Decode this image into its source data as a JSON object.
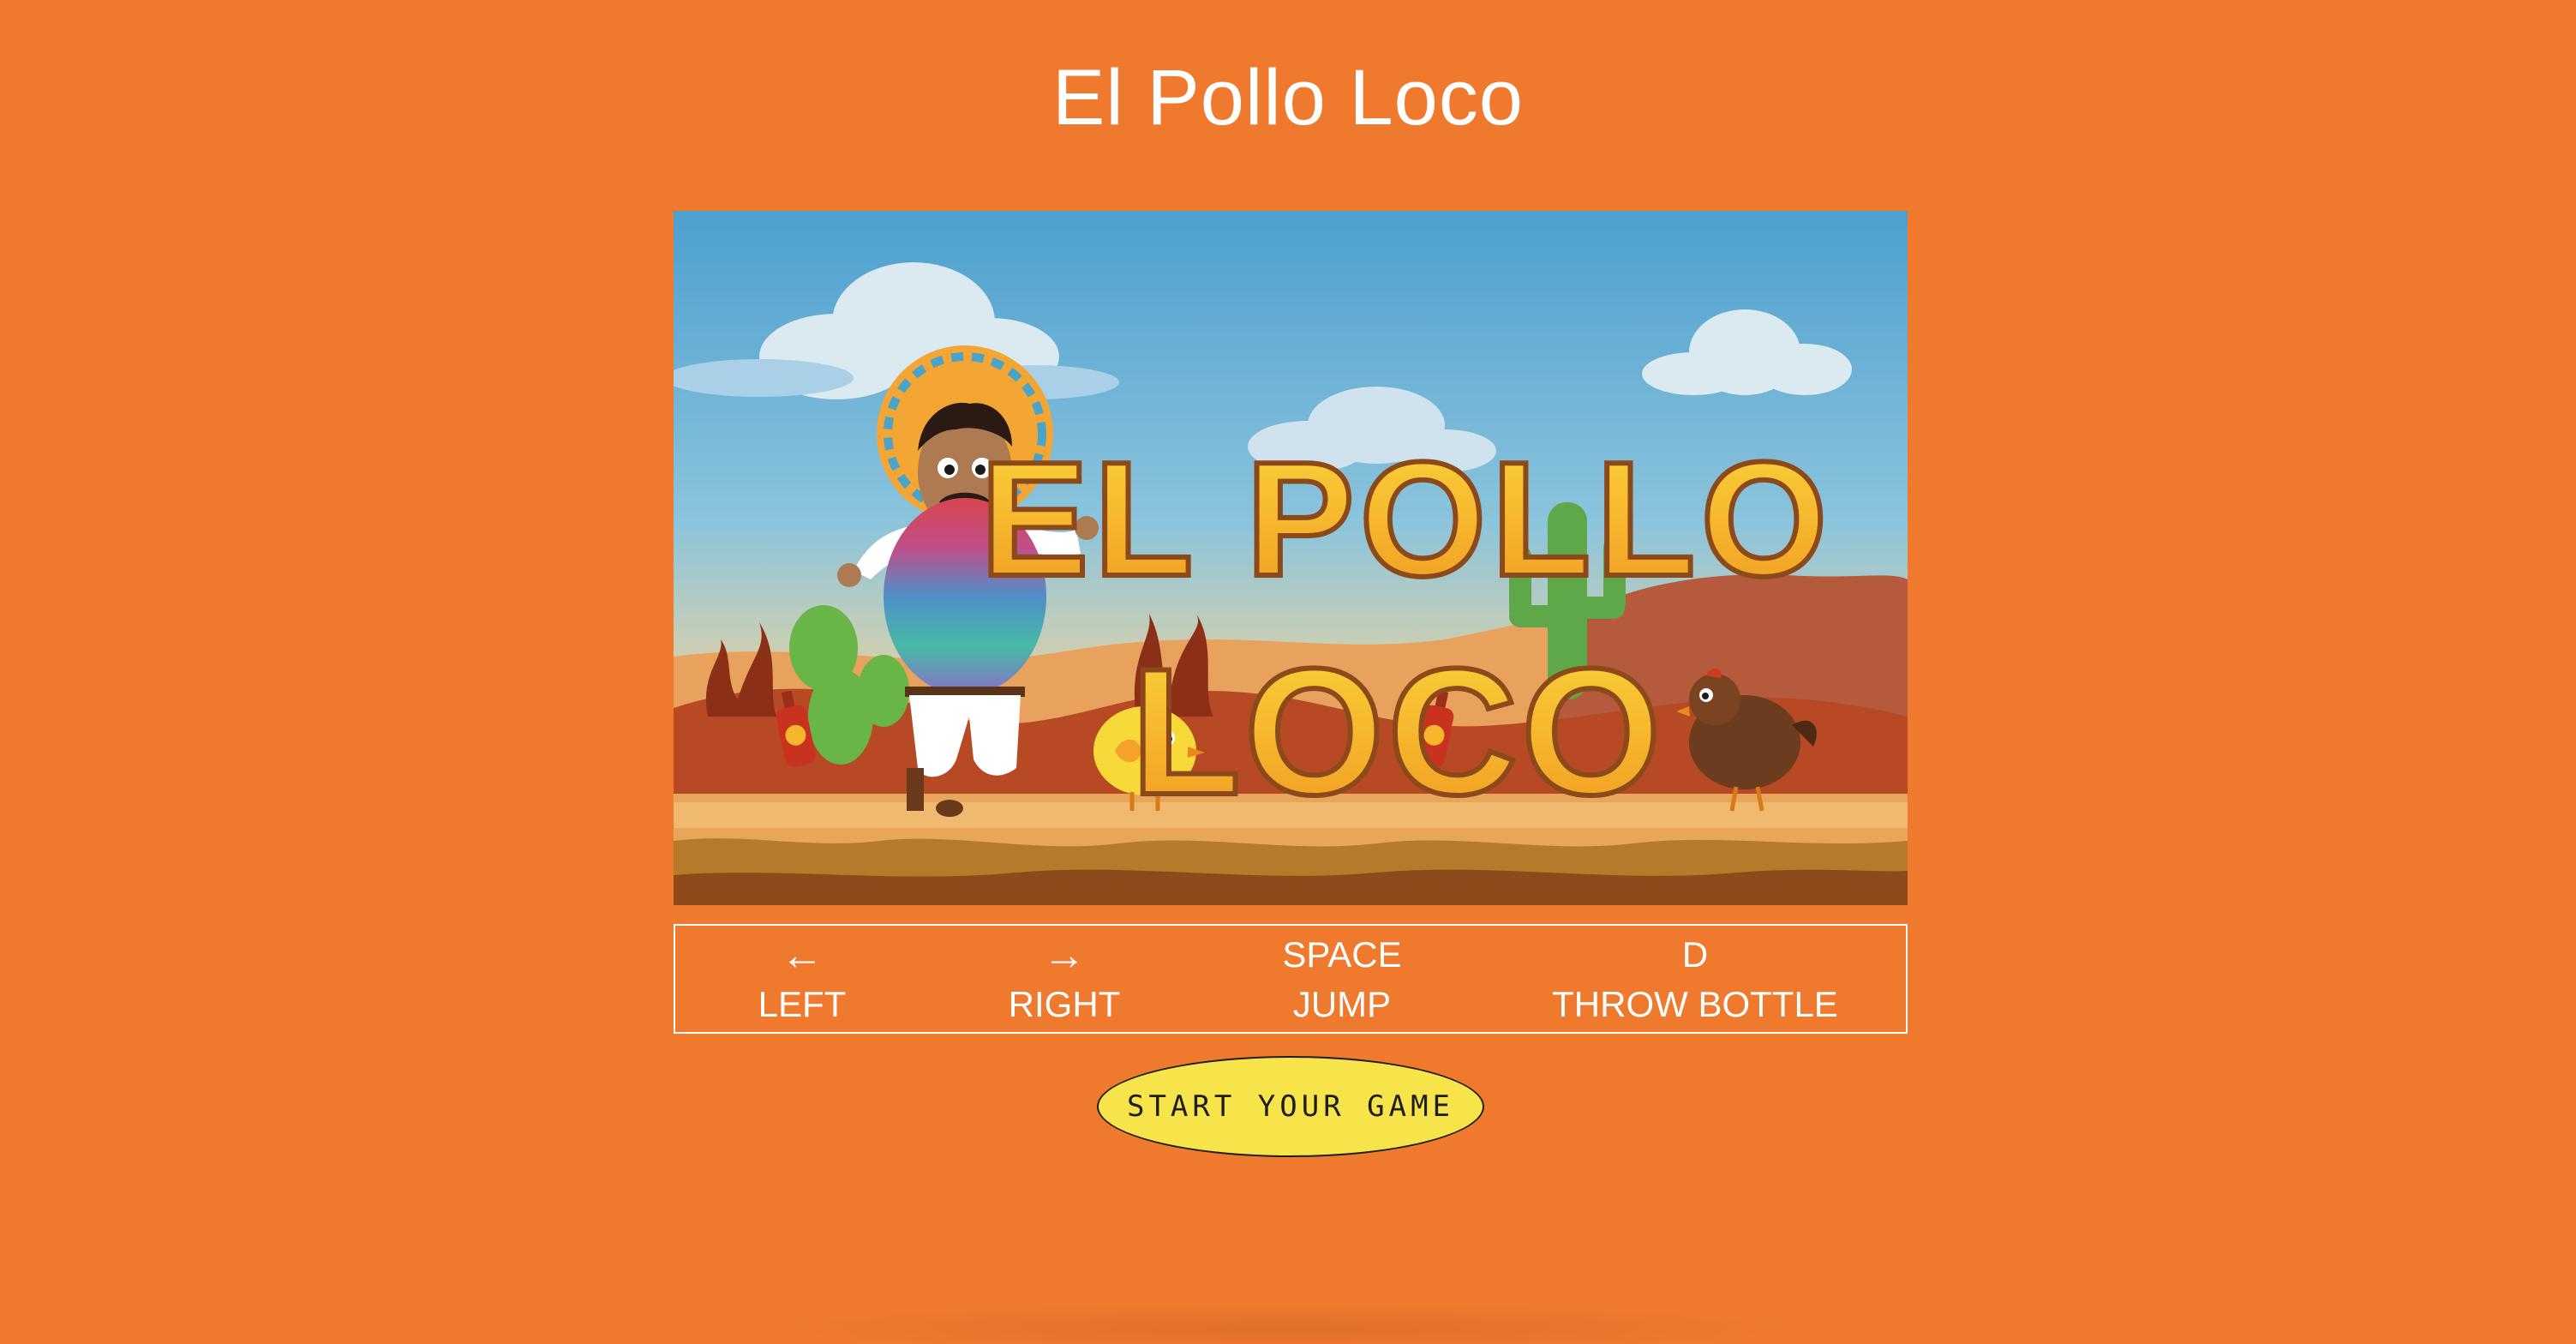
{
  "page": {
    "title": "El Pollo Loco"
  },
  "game_screen": {
    "logo_line_1": "EL POLLO",
    "logo_line_2": "LOCO"
  },
  "controls": [
    {
      "key": "←",
      "action": "LEFT",
      "key_icon": "arrow-left-icon"
    },
    {
      "key": "→",
      "action": "RIGHT",
      "key_icon": "arrow-right-icon"
    },
    {
      "key": "SPACE",
      "action": "JUMP"
    },
    {
      "key": "D",
      "action": "THROW BOTTLE"
    }
  ],
  "start_button": {
    "label": "START YOUR GAME"
  },
  "colors": {
    "background": "#ef7a2e",
    "button": "#f7e34a",
    "text": "#ffffff",
    "logo": "#f5b62b"
  }
}
